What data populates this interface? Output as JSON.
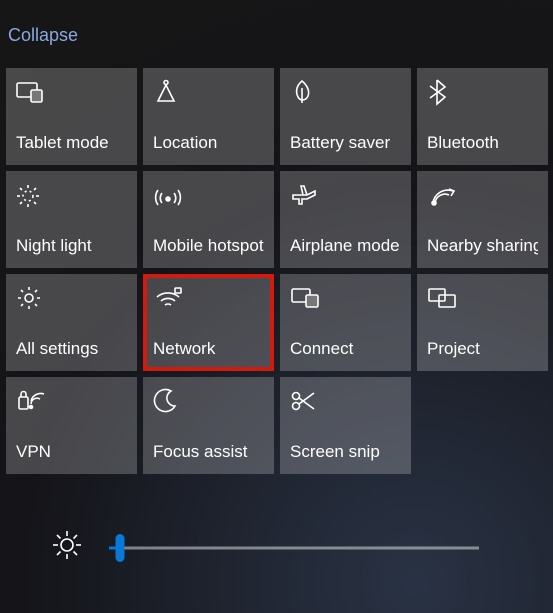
{
  "collapse_label": "Collapse",
  "tiles": [
    {
      "id": "tablet-mode",
      "label": "Tablet mode",
      "icon": "tablet-icon",
      "highlight": false
    },
    {
      "id": "location",
      "label": "Location",
      "icon": "location-icon",
      "highlight": false
    },
    {
      "id": "battery-saver",
      "label": "Battery saver",
      "icon": "leaf-icon",
      "highlight": false
    },
    {
      "id": "bluetooth",
      "label": "Bluetooth",
      "icon": "bluetooth-icon",
      "highlight": false
    },
    {
      "id": "night-light",
      "label": "Night light",
      "icon": "night-light-icon",
      "highlight": false
    },
    {
      "id": "mobile-hotspot",
      "label": "Mobile hotspot",
      "icon": "hotspot-icon",
      "highlight": false
    },
    {
      "id": "airplane-mode",
      "label": "Airplane mode",
      "icon": "airplane-icon",
      "highlight": false
    },
    {
      "id": "nearby-sharing",
      "label": "Nearby sharing",
      "icon": "nearby-share-icon",
      "highlight": false
    },
    {
      "id": "all-settings",
      "label": "All settings",
      "icon": "gear-icon",
      "highlight": false
    },
    {
      "id": "network",
      "label": "Network",
      "icon": "wifi-icon",
      "highlight": true
    },
    {
      "id": "connect",
      "label": "Connect",
      "icon": "connect-icon",
      "highlight": false
    },
    {
      "id": "project",
      "label": "Project",
      "icon": "project-icon",
      "highlight": false
    },
    {
      "id": "vpn",
      "label": "VPN",
      "icon": "vpn-icon",
      "highlight": false
    },
    {
      "id": "focus-assist",
      "label": "Focus assist",
      "icon": "moon-icon",
      "highlight": false
    },
    {
      "id": "screen-snip",
      "label": "Screen snip",
      "icon": "snip-icon",
      "highlight": false
    }
  ],
  "brightness": {
    "value": 3,
    "min": 0,
    "max": 100
  }
}
